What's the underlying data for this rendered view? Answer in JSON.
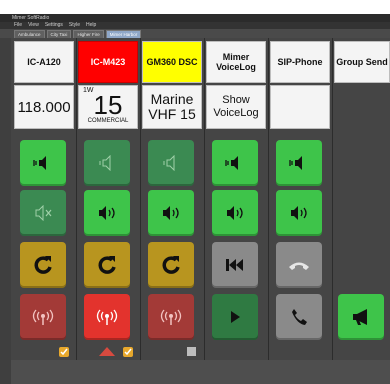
{
  "window": {
    "title": "Mimer SoftRadio"
  },
  "menu": [
    "File",
    "View",
    "Settings",
    "Style",
    "Help"
  ],
  "tabs": [
    {
      "label": "Ambulance",
      "active": false
    },
    {
      "label": "City Taxi",
      "active": false
    },
    {
      "label": "Higher Fire",
      "active": false
    },
    {
      "label": "Mimer Harbor",
      "active": true
    }
  ],
  "columns": [
    {
      "name": "IC-A120",
      "header_color": "#f4f4f4",
      "display": {
        "type": "freq",
        "value": "118.000"
      }
    },
    {
      "name": "IC-M423",
      "header_color": "#ff0000",
      "display": {
        "type": "channel",
        "superscript": "1W",
        "number": "15",
        "caption": "COMMERCIAL"
      }
    },
    {
      "name": "GM360 DSC",
      "header_color": "#ffff00",
      "display": {
        "type": "text",
        "lines": [
          "Marine",
          "VHF 15"
        ]
      }
    },
    {
      "name_lines": [
        "Mimer",
        "VoiceLog"
      ],
      "header_color": "#f4f4f4",
      "display": {
        "type": "text2",
        "lines": [
          "Show",
          "VoiceLog"
        ]
      }
    },
    {
      "name": "SIP-Phone",
      "header_color": "#f4f4f4",
      "display": {
        "type": "empty"
      }
    },
    {
      "name": "Group Send",
      "header_color": "#f4f4f4",
      "display": {
        "type": "empty"
      }
    }
  ],
  "colors": {
    "green_bright": "#3ec44a",
    "green_dim": "#3b8a52",
    "yellow": "#b8951f",
    "red_bright": "#e3332d",
    "red_dim": "#a33a37",
    "gray": "#8a8a8a"
  },
  "icons": {
    "speaker_on": "speaker-on-icon",
    "speaker_muted": "speaker-muted-icon",
    "volume": "volume-icon",
    "refresh": "refresh-icon",
    "rewind": "rewind-icon",
    "hangup": "hangup-icon",
    "transmit": "radio-transmit-icon",
    "play": "play-icon",
    "phone": "phone-icon",
    "megaphone": "megaphone-icon"
  }
}
